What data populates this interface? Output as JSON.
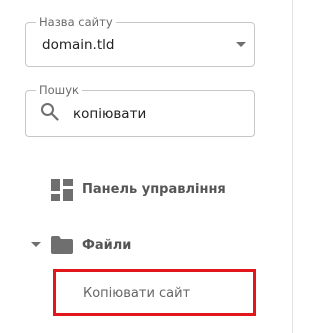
{
  "site_selector": {
    "label": "Назва сайту",
    "value": "domain.tld"
  },
  "search": {
    "label": "Пошук",
    "value": "копіювати"
  },
  "nav": {
    "dashboard": {
      "label": "Панель управління",
      "icon": "dashboard-icon"
    },
    "files": {
      "label": "Файли",
      "icon": "folder-icon",
      "expanded": true,
      "children": [
        {
          "label": "Копіювати сайт",
          "highlighted": true
        }
      ]
    }
  },
  "colors": {
    "highlight_border": "#e2171b",
    "icon_gray": "#6f6f6f"
  }
}
